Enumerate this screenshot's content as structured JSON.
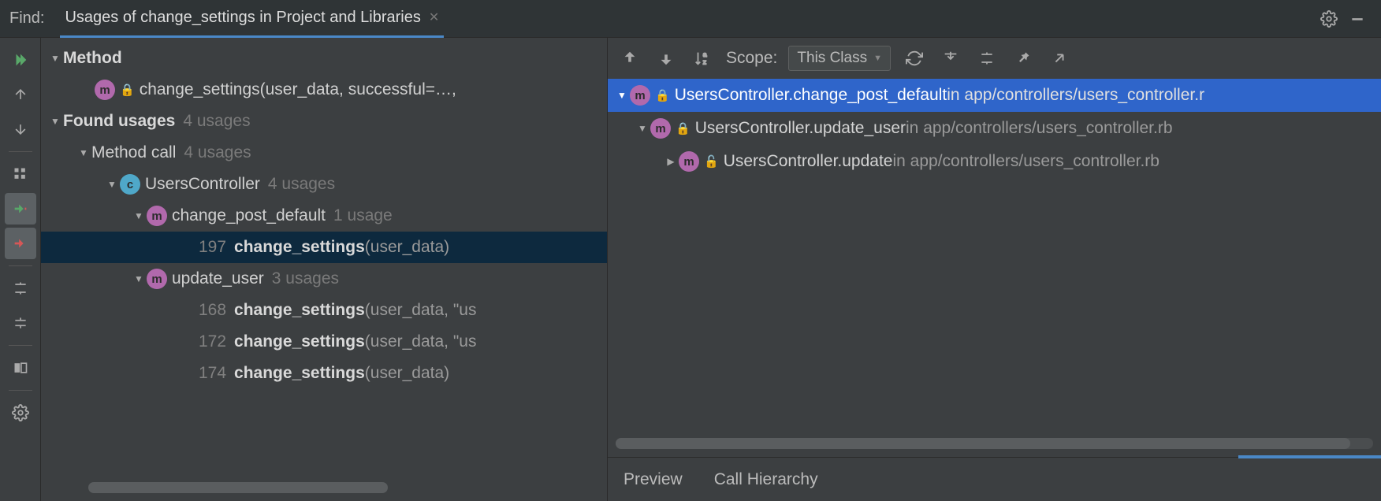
{
  "header": {
    "find_label": "Find:",
    "tab_title": "Usages of change_settings in Project and Libraries"
  },
  "left_tree": {
    "method_label": "Method",
    "method_sig": "change_settings(user_data, successful=…,",
    "found_label": "Found usages",
    "found_count": "4 usages",
    "method_call_label": "Method call",
    "method_call_count": "4 usages",
    "controller_label": "UsersController",
    "controller_count": "4 usages",
    "change_post_label": "change_post_default",
    "change_post_count": "1 usage",
    "usage_197_line": "197",
    "usage_197_bold": "change_settings",
    "usage_197_rest": "(user_data)",
    "update_user_label": "update_user",
    "update_user_count": "3 usages",
    "usage_168_line": "168",
    "usage_168_bold": "change_settings",
    "usage_168_rest": "(user_data, \"us",
    "usage_172_line": "172",
    "usage_172_bold": "change_settings",
    "usage_172_rest": "(user_data, \"us",
    "usage_174_line": "174",
    "usage_174_bold": "change_settings",
    "usage_174_rest": "(user_data)"
  },
  "right_toolbar": {
    "scope_label": "Scope:",
    "scope_value": "This Class"
  },
  "hierarchy": {
    "row1": {
      "label": "UsersController.change_post_default",
      "in": " in ",
      "path": "app/controllers/users_controller.r"
    },
    "row2": {
      "label": "UsersController.update_user",
      "in": " in ",
      "path": "app/controllers/users_controller.rb"
    },
    "row3": {
      "label": "UsersController.update",
      "in": " in ",
      "path": "app/controllers/users_controller.rb"
    }
  },
  "right_tabs": {
    "preview": "Preview",
    "call_hierarchy": "Call Hierarchy"
  }
}
